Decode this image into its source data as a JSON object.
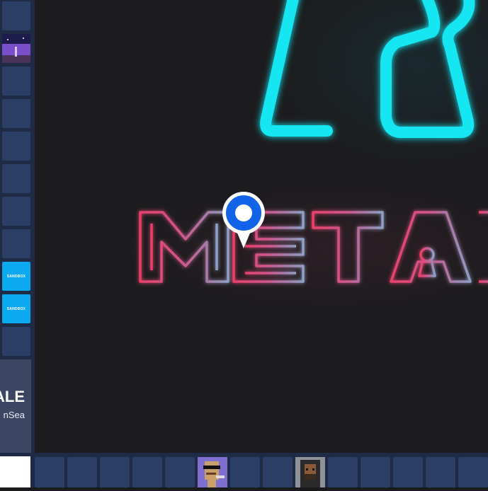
{
  "canvas": {
    "neon_title": "METAL",
    "colors": {
      "cyan_neon": "#14e6f2",
      "pink_neon": "#e8416c",
      "mauve_neon": "#b06a9e",
      "slate_neon": "#8fa0c4",
      "pin_blue": "#1163e8"
    }
  },
  "sidebar": {
    "tiles": [
      {
        "kind": "empty"
      },
      {
        "kind": "image",
        "icon": "purple-scene-thumbnail"
      },
      {
        "kind": "empty"
      },
      {
        "kind": "empty"
      },
      {
        "kind": "empty"
      },
      {
        "kind": "empty"
      },
      {
        "kind": "empty"
      },
      {
        "kind": "empty"
      },
      {
        "kind": "sandbox",
        "label": "SANDBOX"
      },
      {
        "kind": "sandbox",
        "label": "SANDBOX"
      },
      {
        "kind": "empty"
      }
    ]
  },
  "promo": {
    "headline": "ALE",
    "source": "nSea"
  },
  "bottom_bar": {
    "tiles": [
      {
        "kind": "empty"
      },
      {
        "kind": "empty"
      },
      {
        "kind": "empty"
      },
      {
        "kind": "empty"
      },
      {
        "kind": "empty"
      },
      {
        "kind": "punk",
        "icon": "pixel-avatar-sunglasses"
      },
      {
        "kind": "empty"
      },
      {
        "kind": "empty"
      },
      {
        "kind": "punk",
        "icon": "pixel-avatar-hoodie"
      },
      {
        "kind": "empty"
      },
      {
        "kind": "empty"
      },
      {
        "kind": "empty"
      },
      {
        "kind": "empty"
      },
      {
        "kind": "empty"
      }
    ]
  },
  "map_pin": {
    "icon": "location-pin-icon",
    "color": "#1163e8"
  }
}
